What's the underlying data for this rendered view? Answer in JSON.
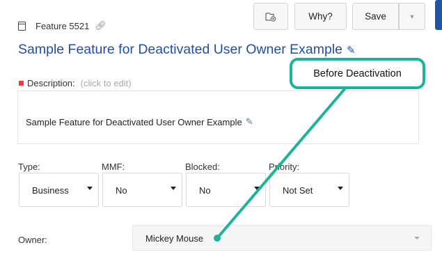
{
  "feature": {
    "id_label": "Feature 5521",
    "title": "Sample Feature for Deactivated User Owner Example"
  },
  "toolbar": {
    "why_label": "Why?",
    "save_label": "Save"
  },
  "description": {
    "label": "Description:",
    "hint": "(click to edit)",
    "text": "Sample Feature for Deactivated User Owner Example"
  },
  "fields": {
    "type": {
      "label": "Type:",
      "value": "Business"
    },
    "mmf": {
      "label": "MMF:",
      "value": "No"
    },
    "blocked": {
      "label": "Blocked:",
      "value": "No"
    },
    "priority": {
      "label": "Priority:",
      "value": "Not Set"
    }
  },
  "owner": {
    "label": "Owner:",
    "value": "Mickey Mouse"
  },
  "annotation": {
    "callout_text": "Before Deactivation",
    "color": "#1bb39a"
  },
  "icons": [
    "document-icon",
    "link-icon",
    "folder-add-icon",
    "pencil-icon",
    "caret-down-icon"
  ],
  "colors": {
    "title": "#1f4fa5",
    "primary_button": "#1f56a8",
    "required_marker": "#ee3b3b"
  }
}
